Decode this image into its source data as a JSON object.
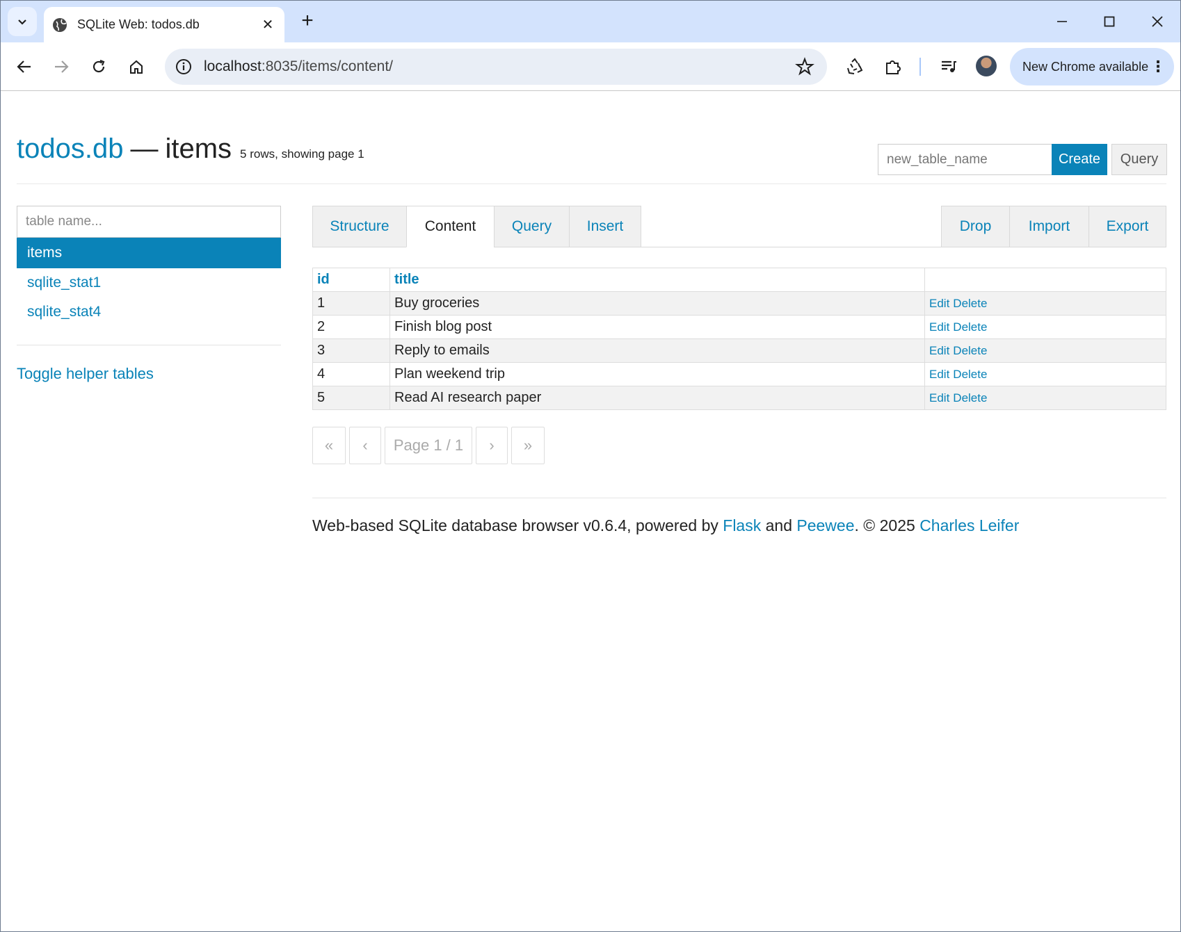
{
  "browser": {
    "tab_title": "SQLite Web: todos.db",
    "url_host": "localhost",
    "url_path": ":8035/items/content/",
    "update_label": "New Chrome available"
  },
  "page": {
    "db_name": "todos.db",
    "separator": "—",
    "table_name": "items",
    "row_meta": "5 rows, showing page 1",
    "new_table_placeholder": "new_table_name",
    "create_label": "Create",
    "query_label": "Query"
  },
  "sidebar": {
    "filter_placeholder": "table name...",
    "tables": [
      "items",
      "sqlite_stat1",
      "sqlite_stat4"
    ],
    "toggle_label": "Toggle helper tables"
  },
  "tabs": {
    "structure": "Structure",
    "content": "Content",
    "query": "Query",
    "insert": "Insert",
    "drop": "Drop",
    "import": "Import",
    "export": "Export"
  },
  "table": {
    "columns": [
      "id",
      "title"
    ],
    "rows": [
      {
        "id": "1",
        "title": "Buy groceries"
      },
      {
        "id": "2",
        "title": "Finish blog post"
      },
      {
        "id": "3",
        "title": "Reply to emails"
      },
      {
        "id": "4",
        "title": "Plan weekend trip"
      },
      {
        "id": "5",
        "title": "Read AI research paper"
      }
    ],
    "edit_label": "Edit",
    "delete_label": "Delete"
  },
  "pager": {
    "first": "«",
    "prev": "‹",
    "page": "Page 1 / 1",
    "next": "›",
    "last": "»"
  },
  "footer": {
    "text1": "Web-based SQLite database browser v0.6.4, powered by ",
    "flask": "Flask",
    "text2": " and ",
    "peewee": "Peewee",
    "text3": ". © 2025 ",
    "author": "Charles Leifer"
  }
}
